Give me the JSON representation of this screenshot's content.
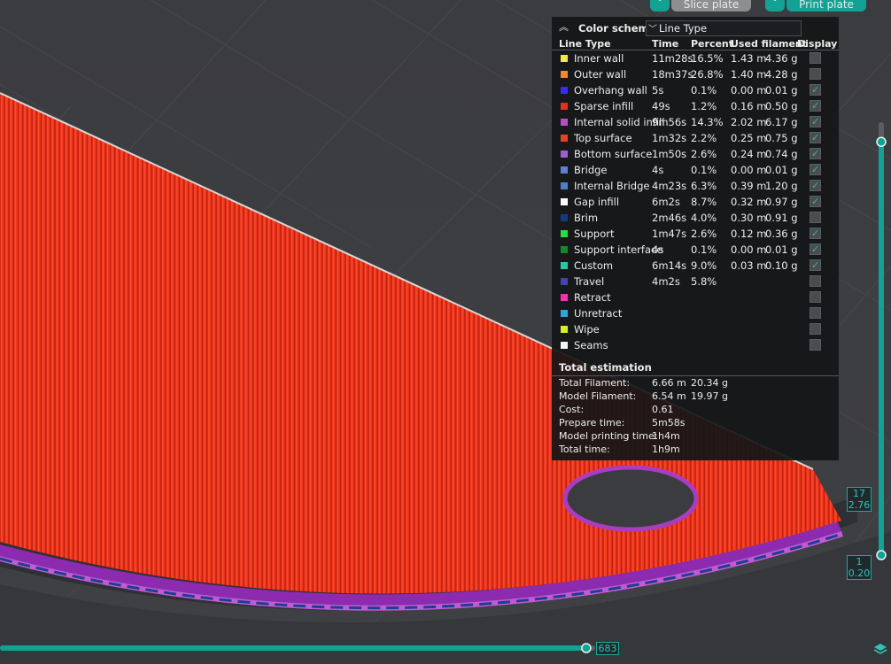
{
  "toolbar": {
    "slice_label": "Slice plate",
    "print_label": "Print plate"
  },
  "colors": {
    "accent": "#11a294",
    "print_red": "#e5361c",
    "panel_bg": "#141517"
  },
  "color_scheme": {
    "title": "Color scheme",
    "selected": "Line Type"
  },
  "table": {
    "headers": {
      "line_type": "Line Type",
      "time": "Time",
      "percent": "Percent",
      "used_filament": "Used filament",
      "display": "Display"
    },
    "rows": [
      {
        "name": "Inner wall",
        "color": "#f2e74b",
        "time": "11m28s",
        "percent": "16.5%",
        "length": "1.43 m",
        "weight": "4.36 g",
        "display": false
      },
      {
        "name": "Outer wall",
        "color": "#f08a2b",
        "time": "18m37s",
        "percent": "26.8%",
        "length": "1.40 m",
        "weight": "4.28 g",
        "display": false
      },
      {
        "name": "Overhang wall",
        "color": "#3a2df2",
        "time": "5s",
        "percent": "0.1%",
        "length": "0.00 m",
        "weight": "0.01 g",
        "display": true
      },
      {
        "name": "Sparse infill",
        "color": "#e0331f",
        "time": "49s",
        "percent": "1.2%",
        "length": "0.16 m",
        "weight": "0.50 g",
        "display": true
      },
      {
        "name": "Internal solid infill",
        "color": "#b84cc6",
        "time": "9m56s",
        "percent": "14.3%",
        "length": "2.02 m",
        "weight": "6.17 g",
        "display": true
      },
      {
        "name": "Top surface",
        "color": "#e5431e",
        "time": "1m32s",
        "percent": "2.2%",
        "length": "0.25 m",
        "weight": "0.75 g",
        "display": true
      },
      {
        "name": "Bottom surface",
        "color": "#9b5fd1",
        "time": "1m50s",
        "percent": "2.6%",
        "length": "0.24 m",
        "weight": "0.74 g",
        "display": true
      },
      {
        "name": "Bridge",
        "color": "#5f7ed4",
        "time": "4s",
        "percent": "0.1%",
        "length": "0.00 m",
        "weight": "0.01 g",
        "display": true
      },
      {
        "name": "Internal Bridge",
        "color": "#4f7fc9",
        "time": "4m23s",
        "percent": "6.3%",
        "length": "0.39 m",
        "weight": "1.20 g",
        "display": true
      },
      {
        "name": "Gap infill",
        "color": "#ffffff",
        "time": "6m2s",
        "percent": "8.7%",
        "length": "0.32 m",
        "weight": "0.97 g",
        "display": true
      },
      {
        "name": "Brim",
        "color": "#123a82",
        "time": "2m46s",
        "percent": "4.0%",
        "length": "0.30 m",
        "weight": "0.91 g",
        "display": false
      },
      {
        "name": "Support",
        "color": "#24e03c",
        "time": "1m47s",
        "percent": "2.6%",
        "length": "0.12 m",
        "weight": "0.36 g",
        "display": true
      },
      {
        "name": "Support interface",
        "color": "#138a2a",
        "time": "4s",
        "percent": "0.1%",
        "length": "0.00 m",
        "weight": "0.01 g",
        "display": true
      },
      {
        "name": "Custom",
        "color": "#25c9a6",
        "time": "6m14s",
        "percent": "9.0%",
        "length": "0.03 m",
        "weight": "0.10 g",
        "display": true
      },
      {
        "name": "Travel",
        "color": "#4343b5",
        "time": "4m2s",
        "percent": "5.8%",
        "length": "",
        "weight": "",
        "display": false
      },
      {
        "name": "Retract",
        "color": "#ee33b5",
        "time": "",
        "percent": "",
        "length": "",
        "weight": "",
        "display": false
      },
      {
        "name": "Unretract",
        "color": "#2ba6dc",
        "time": "",
        "percent": "",
        "length": "",
        "weight": "",
        "display": false
      },
      {
        "name": "Wipe",
        "color": "#d8ee22",
        "time": "",
        "percent": "",
        "length": "",
        "weight": "",
        "display": false
      },
      {
        "name": "Seams",
        "color": "#f4f4f4",
        "time": "",
        "percent": "",
        "length": "",
        "weight": "",
        "display": false
      }
    ]
  },
  "total_estimation": {
    "title": "Total estimation",
    "rows": [
      {
        "label": "Total Filament:",
        "v1": "6.66 m",
        "v2": "20.34 g"
      },
      {
        "label": "Model Filament:",
        "v1": "6.54 m",
        "v2": "19.97 g"
      },
      {
        "label": "Cost:",
        "v1": "0.61",
        "v2": ""
      },
      {
        "label": "Prepare time:",
        "v1": "5m58s",
        "v2": ""
      },
      {
        "label": "Model printing time:",
        "v1": "1h4m",
        "v2": ""
      },
      {
        "label": "Total time:",
        "v1": "1h9m",
        "v2": ""
      }
    ]
  },
  "layer_slider": {
    "top_layer": "17",
    "top_height": "2.76",
    "bottom_layer": "1",
    "bottom_height": "0.20",
    "progress": 0.955
  },
  "move_slider": {
    "value": "683",
    "progress": 0.985
  }
}
